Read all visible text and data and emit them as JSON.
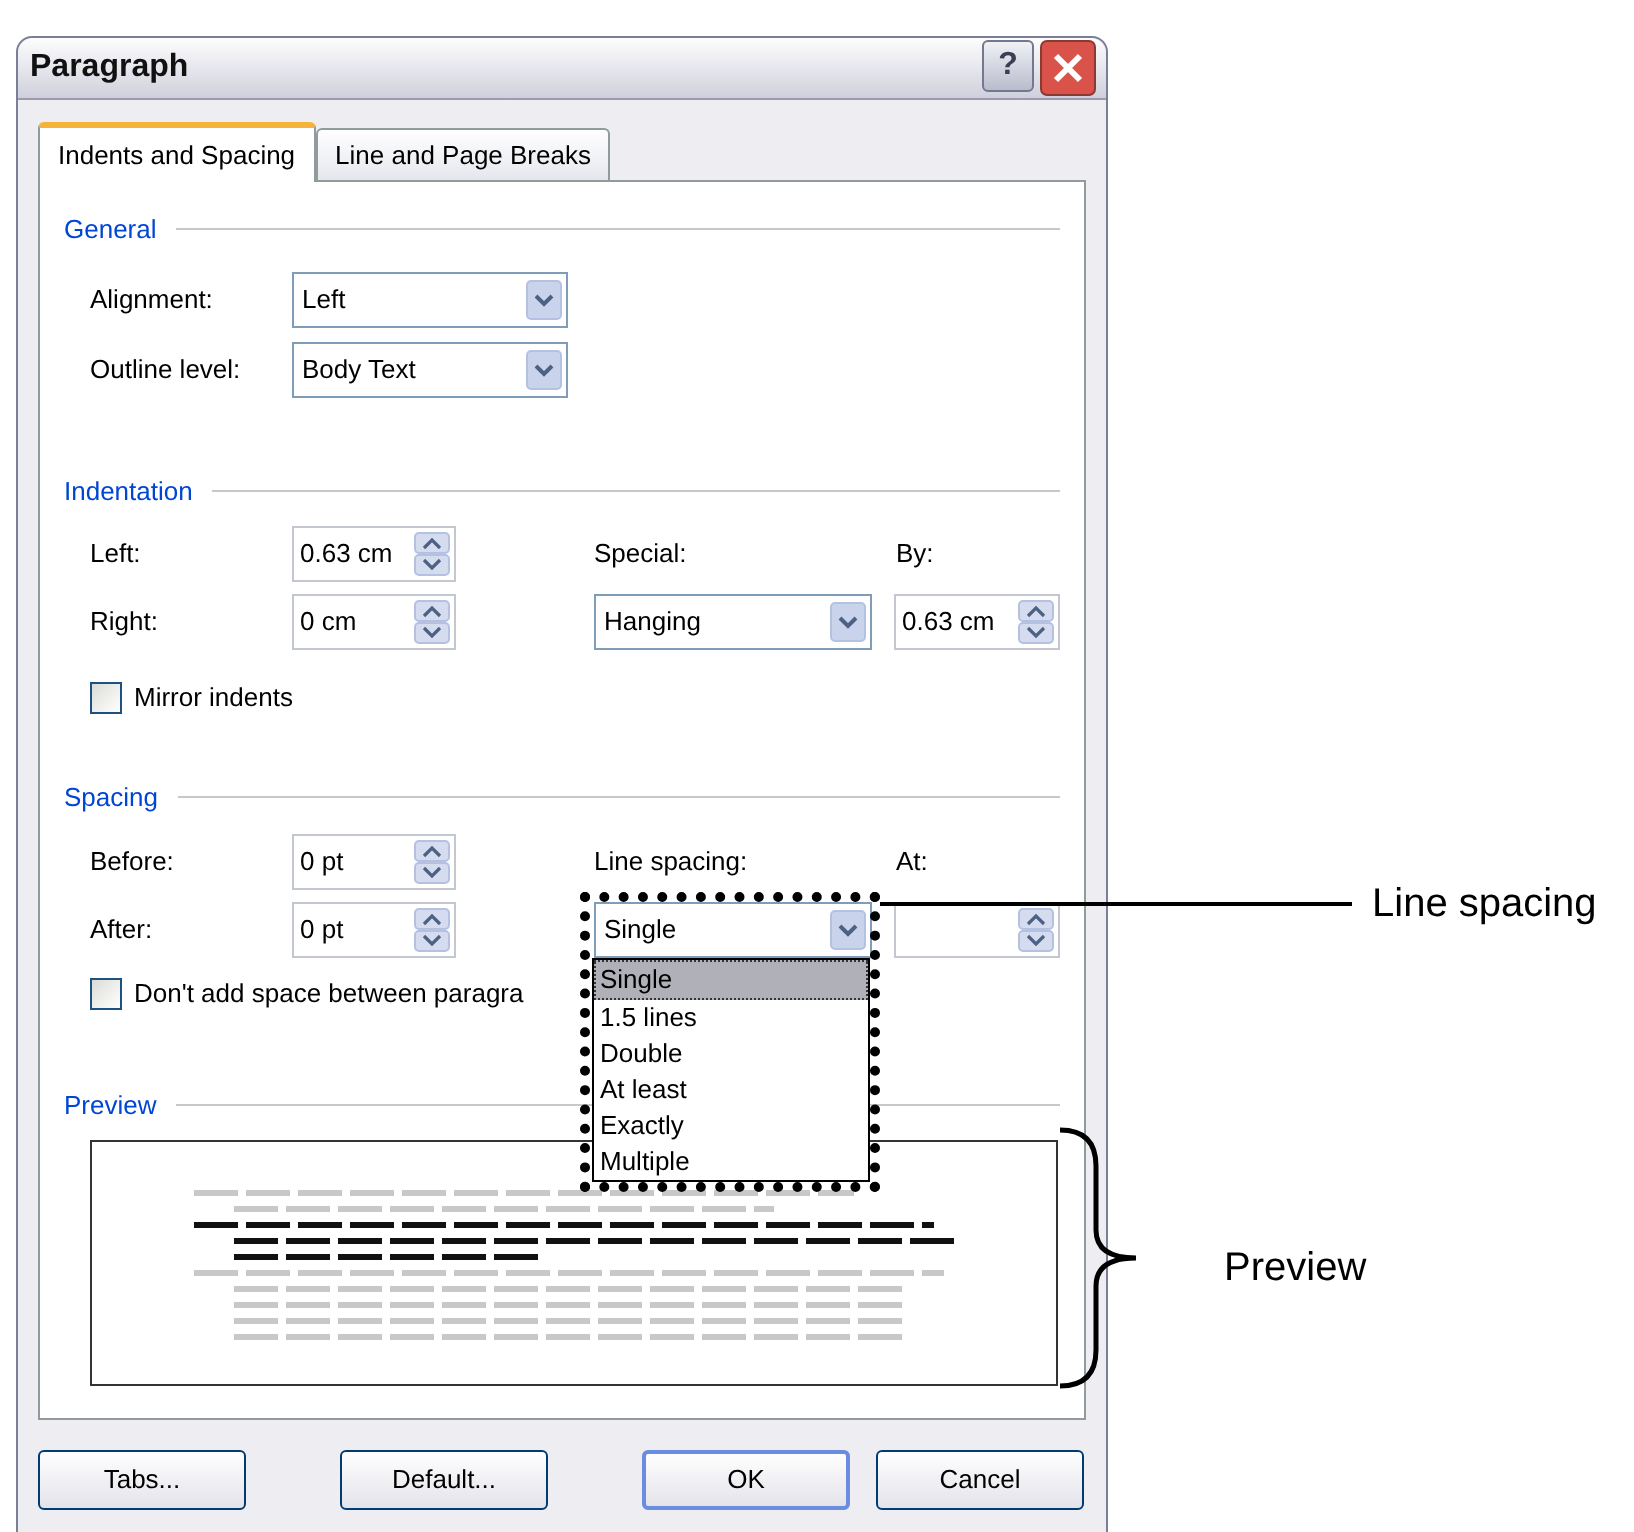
{
  "window": {
    "title": "Paragraph",
    "help": "?"
  },
  "tabs": [
    {
      "label": "Indents and Spacing",
      "selected": true
    },
    {
      "label": "Line and Page Breaks",
      "selected": false
    }
  ],
  "general": {
    "heading": "General",
    "alignment": {
      "label": "Alignment:",
      "value": "Left"
    },
    "outline_level": {
      "label": "Outline level:",
      "value": "Body Text"
    }
  },
  "indentation": {
    "heading": "Indentation",
    "left": {
      "label": "Left:",
      "value": "0.63 cm"
    },
    "right": {
      "label": "Right:",
      "value": "0 cm"
    },
    "special": {
      "label": "Special:",
      "value": "Hanging"
    },
    "by": {
      "label": "By:",
      "value": "0.63 cm"
    },
    "mirror_indents": {
      "label": "Mirror indents",
      "checked": false
    }
  },
  "spacing": {
    "heading": "Spacing",
    "before": {
      "label": "Before:",
      "value": "0 pt"
    },
    "after": {
      "label": "After:",
      "value": "0 pt"
    },
    "line_spacing": {
      "label": "Line spacing:",
      "value": "Single",
      "expanded": true,
      "options": [
        {
          "label": "Single",
          "selected": true
        },
        {
          "label": "1.5 lines",
          "selected": false
        },
        {
          "label": "Double",
          "selected": false
        },
        {
          "label": "At least",
          "selected": false
        },
        {
          "label": "Exactly",
          "selected": false
        },
        {
          "label": "Multiple",
          "selected": false
        }
      ]
    },
    "at": {
      "label": "At:"
    },
    "dont_add_space": {
      "label": "Don't add space between paragra",
      "checked": false
    }
  },
  "preview": {
    "heading": "Preview"
  },
  "buttons": [
    {
      "label": "Tabs...",
      "default": false
    },
    {
      "label": "Default...",
      "default": false
    },
    {
      "label": "OK",
      "default": true
    },
    {
      "label": "Cancel",
      "default": false
    }
  ],
  "annotations": [
    {
      "kind": "line",
      "text": "Line spacing"
    },
    {
      "kind": "brace",
      "text": "Preview"
    }
  ]
}
